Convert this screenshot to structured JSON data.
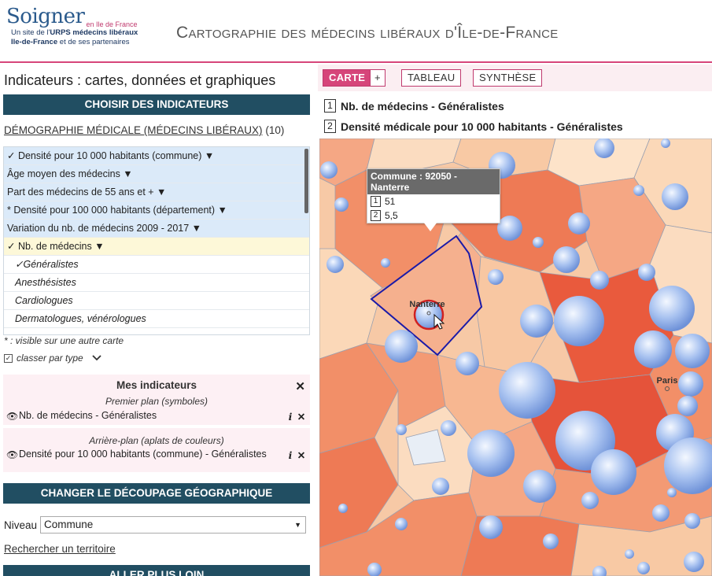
{
  "header": {
    "logo_main": "Soigner",
    "logo_sub": "en Ile de France",
    "logo_tag_1_prefix": "Un site de l'",
    "logo_tag_1_bold": "URPS médecins libéraux",
    "logo_tag_2_bold": "Ile-de-France",
    "logo_tag_2_suffix": " et de ses partenaires",
    "title": "Cartographie des médecins libéraux d'Île-de-France"
  },
  "left": {
    "title": "Indicateurs : cartes, données et graphiques",
    "section_indicateurs": "CHOISIR DES INDICATEURS",
    "category_name": "DÉMOGRAPHIE MÉDICALE (MÉDECINS LIBÉRAUX)",
    "category_count": "(10)",
    "list_items": [
      {
        "label": "✓ Densité pour 10 000 habitants (commune) ▼",
        "style": "blue"
      },
      {
        "label": "Âge moyen des médecins ▼",
        "style": "blue"
      },
      {
        "label": "Part des médecins de 55 ans et + ▼",
        "style": "blue"
      },
      {
        "label": "* Densité pour 100 000 habitants (département) ▼",
        "style": "blue"
      },
      {
        "label": "Variation du nb. de médecins 2009 - 2017 ▼",
        "style": "blue"
      },
      {
        "label": "✓ Nb. de médecins ▼",
        "style": "yellow"
      },
      {
        "label": "✓Généralistes",
        "style": "sub"
      },
      {
        "label": "Anesthésistes",
        "style": "sub"
      },
      {
        "label": "Cardiologues",
        "style": "sub"
      },
      {
        "label": "Dermatologues, vénérologues",
        "style": "sub"
      }
    ],
    "note": "* : visible sur une autre carte",
    "classer_label": "classer par type",
    "mes": {
      "title": "Mes indicateurs",
      "premier_plan": "Premier plan (symboles)",
      "premier_item": "Nb. de médecins - Généralistes",
      "arriere_plan": "Arrière-plan (aplats de couleurs)",
      "arriere_item": "Densité pour 10 000 habitants (commune) - Généralistes"
    },
    "section_decoupage": "CHANGER LE DÉCOUPAGE GÉOGRAPHIQUE",
    "niveau_label": "Niveau",
    "niveau_value": "Commune",
    "search_link": "Rechercher un territoire",
    "section_aller": "ALLER PLUS LOIN"
  },
  "right": {
    "tabs": [
      "CARTE",
      "+",
      "TABLEAU",
      "SYNTHÈSE"
    ],
    "legend_1": "Nb. de médecins - Généralistes",
    "legend_2": "Densité médicale pour 10 000 habitants - Généralistes",
    "tooltip": {
      "title": "Commune : 92050 - Nanterre",
      "value_1": "51",
      "value_2": "5,5"
    },
    "map_labels": {
      "nanterre": "Nanterre",
      "paris": "Paris"
    }
  },
  "colors": {
    "accent": "#d6457a",
    "section_bar": "#214e62",
    "bubble": "#8fb0ea"
  }
}
